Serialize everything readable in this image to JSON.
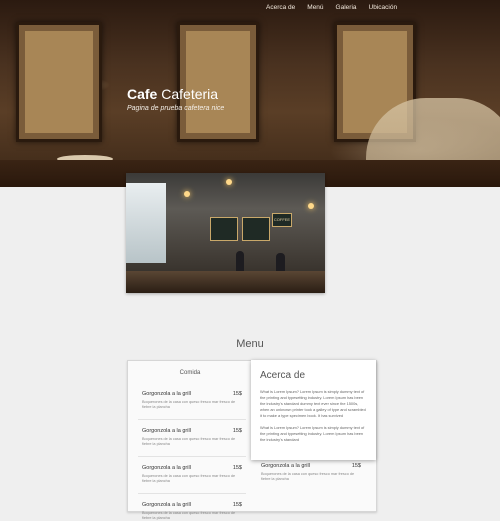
{
  "nav": {
    "items": [
      "Acerca de",
      "Menú",
      "Galeria",
      "Ubicación"
    ]
  },
  "hero": {
    "title_bold": "Cafe",
    "title_light": "Cafeteria",
    "subtitle": "Pagina de prueba cafetera nice"
  },
  "photo": {
    "sign_text": "COFFEE"
  },
  "menu": {
    "title": "Menu",
    "column_heading": "Comida",
    "items": [
      {
        "name": "Gorgonzola a la grill",
        "price": "15$",
        "description": "Boquerones de la casa con queso fresco mar fresco de fiebre la plancha"
      },
      {
        "name": "Gorgonzola a la grill",
        "price": "15$",
        "description": "Boquerones de la casa con queso fresco mar fresco de fiebre la plancha"
      },
      {
        "name": "Gorgonzola a la grill",
        "price": "15$",
        "description": "Boquerones de la casa con queso fresco mar fresco de fiebre la plancha"
      },
      {
        "name": "Gorgonzola a la grill",
        "price": "15$",
        "description": "Boquerones de la casa con queso fresco mar fresco de fiebre la plancha"
      }
    ],
    "right_items": [
      {
        "name": "Gorgonzola a la grill",
        "price": "15$",
        "description": "Boquerones de la casa con queso fresco mar fresco de fiebre la plancha"
      }
    ]
  },
  "about": {
    "title": "Acerca de",
    "paragraph1": "What is Lorem Ipsum? Lorem Ipsum is simply dummy text of the printing and typesetting industry. Lorem Ipsum has been the industry's standard dummy text ever since the 1500s, when an unknown printer took a galley of type and scrambled it to make a type specimen book. It has survived",
    "paragraph2": "What is Lorem Ipsum? Lorem Ipsum is simply dummy text of the printing and typesetting industry. Lorem Ipsum has been the industry's standard"
  }
}
